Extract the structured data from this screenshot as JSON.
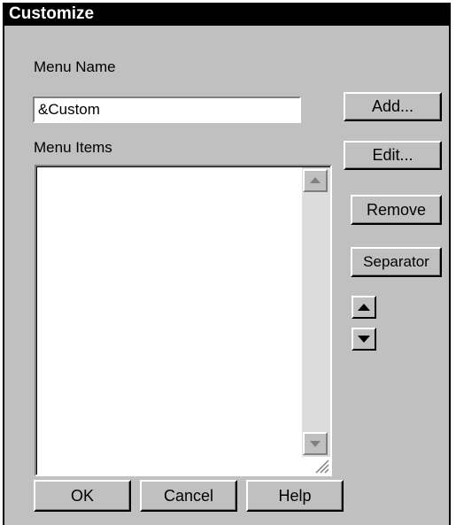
{
  "window": {
    "title": "Customize"
  },
  "menu_name": {
    "label": "Menu Name",
    "value": "&Custom"
  },
  "menu_items": {
    "label": "Menu Items",
    "items": []
  },
  "side_buttons": {
    "add": "Add...",
    "edit": "Edit...",
    "remove": "Remove",
    "separator": "Separator"
  },
  "bottom_buttons": {
    "ok": "OK",
    "cancel": "Cancel",
    "help": "Help"
  },
  "icons": {
    "move_up": "up-arrow-icon",
    "move_down": "down-arrow-icon",
    "scroll_up": "scroll-up-arrow-icon",
    "scroll_down": "scroll-down-arrow-icon",
    "resize": "resize-grip-icon"
  },
  "colors": {
    "dialog_background": "#c0c0c0",
    "titlebar_background": "#000000",
    "titlebar_text": "#ffffff"
  }
}
